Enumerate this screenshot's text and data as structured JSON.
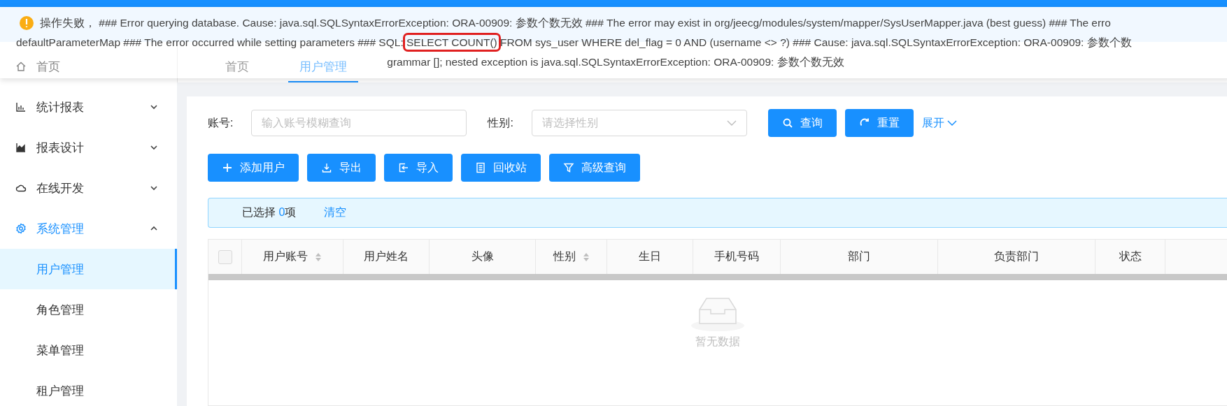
{
  "notification": {
    "lines": [
      {
        "text": "操作失败， ### Error querying database. Cause: java.sql.SQLSyntaxErrorException: ORA-00909: 参数个数无效 ### The error may exist in org/jeecg/modules/system/mapper/SysUserMapper.java (best guess) ### The erro"
      },
      {
        "text": "defaultParameterMap ### The error occurred while setting parameters ### SQL: ",
        "highlight": "SELECT COUNT()",
        "after": " FROM sys_user WHERE del_flag = 0 AND (username <> ?) ### Cause: java.sql.SQLSyntaxErrorException: ORA-00909: 参数个数"
      },
      {
        "text": "grammar []; nested exception is java.sql.SQLSyntaxErrorException: ORA-00909: 参数个数无效"
      }
    ]
  },
  "sidebar": {
    "items": [
      {
        "label": "首页",
        "selected": false
      },
      {
        "label": "统计报表",
        "expanded": false,
        "selected": false
      },
      {
        "label": "报表设计",
        "expanded": false,
        "selected": false
      },
      {
        "label": "在线开发",
        "expanded": false,
        "selected": false
      },
      {
        "label": "系统管理",
        "expanded": true,
        "selected": true,
        "children": [
          {
            "label": "用户管理",
            "selected": true
          },
          {
            "label": "角色管理",
            "selected": false
          },
          {
            "label": "菜单管理",
            "selected": false
          },
          {
            "label": "租户管理",
            "selected": false
          }
        ]
      }
    ]
  },
  "tabs": [
    {
      "label": "首页",
      "selected": false
    },
    {
      "label": "用户管理",
      "selected": true
    }
  ],
  "filters": [
    {
      "label": "账号:",
      "placeholder": "输入账号模糊查询",
      "kind": "input"
    },
    {
      "label": "性别:",
      "placeholder": "请选择性别",
      "kind": "select"
    }
  ],
  "search_buttons": [
    {
      "label": "查询"
    },
    {
      "label": "重置"
    }
  ],
  "expand_link": "展开",
  "toolbar": [
    {
      "label": "添加用户"
    },
    {
      "label": "导出"
    },
    {
      "label": "导入"
    },
    {
      "label": "回收站"
    },
    {
      "label": "高级查询"
    }
  ],
  "selection": {
    "prefix": "已选择 ",
    "count": "0",
    "suffix": "项",
    "clear": "清空"
  },
  "table": {
    "select_all": {
      "checked": false
    },
    "columns": [
      {
        "label": "用户账号",
        "sortable": true
      },
      {
        "label": "用户姓名",
        "sortable": false
      },
      {
        "label": "头像",
        "sortable": false
      },
      {
        "label": "性别",
        "sortable": true
      },
      {
        "label": "生日",
        "sortable": false
      },
      {
        "label": "手机号码",
        "sortable": false
      },
      {
        "label": "部门",
        "sortable": false
      },
      {
        "label": "负责部门",
        "sortable": false
      },
      {
        "label": "状态",
        "sortable": false
      }
    ],
    "empty_text": "暂无数据"
  }
}
